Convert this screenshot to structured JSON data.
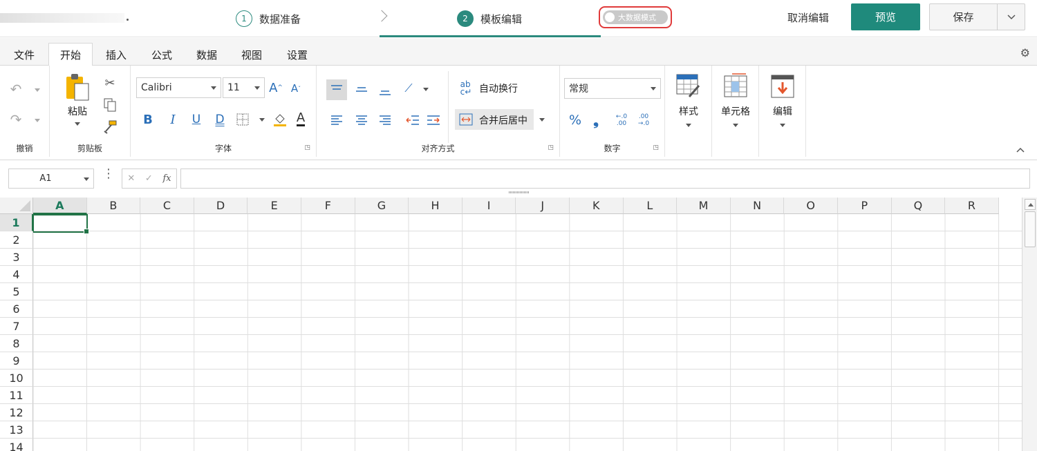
{
  "topbar": {
    "steps": [
      {
        "num": "1",
        "label": "数据准备"
      },
      {
        "num": "2",
        "label": "模板编辑"
      }
    ],
    "big_data_mode": "大数据模式",
    "cancel_edit": "取消编辑",
    "preview": "预览",
    "save": "保存"
  },
  "tabs": [
    "文件",
    "开始",
    "插入",
    "公式",
    "数据",
    "视图",
    "设置"
  ],
  "active_tab": "开始",
  "ribbon": {
    "undo_group": "撤销",
    "clipboard": {
      "paste": "粘贴",
      "group": "剪贴板"
    },
    "font": {
      "family": "Calibri",
      "size": "11",
      "group": "字体"
    },
    "align": {
      "wrap": "自动换行",
      "merge": "合并后居中",
      "group": "对齐方式"
    },
    "number": {
      "format": "常规",
      "group": "数字"
    },
    "style": "样式",
    "cell": "单元格",
    "edit": "编辑"
  },
  "formula_bar": {
    "name_box": "A1",
    "fx": "fx",
    "value": ""
  },
  "grid": {
    "columns": [
      "A",
      "B",
      "C",
      "D",
      "E",
      "F",
      "G",
      "H",
      "I",
      "J",
      "K",
      "L",
      "M",
      "N",
      "O",
      "P",
      "Q",
      "R"
    ],
    "rows": [
      "1",
      "2",
      "3",
      "4",
      "5",
      "6",
      "7",
      "8",
      "9",
      "10",
      "11",
      "12",
      "13",
      "14"
    ],
    "selected": "A1"
  },
  "colors": {
    "accent": "#1f8a7c",
    "selection": "#217346",
    "highlight_box": "#e03a3a"
  }
}
